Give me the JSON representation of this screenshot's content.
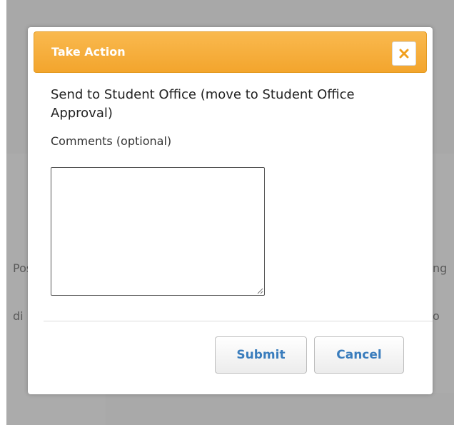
{
  "dialog": {
    "title": "Take Action",
    "heading": "Send to Student Office (move to Student Office Approval)",
    "comments_label": "Comments (optional)",
    "comments_value": "",
    "submit_label": "Submit",
    "cancel_label": "Cancel",
    "close_icon": "close-icon",
    "accent_color": "#f5a830",
    "button_text_color": "#3a7dbd"
  },
  "background": {
    "left_text_1": "Pos",
    "left_text_2": "di",
    "right_text_1": "ng",
    "right_text_2": "o"
  }
}
